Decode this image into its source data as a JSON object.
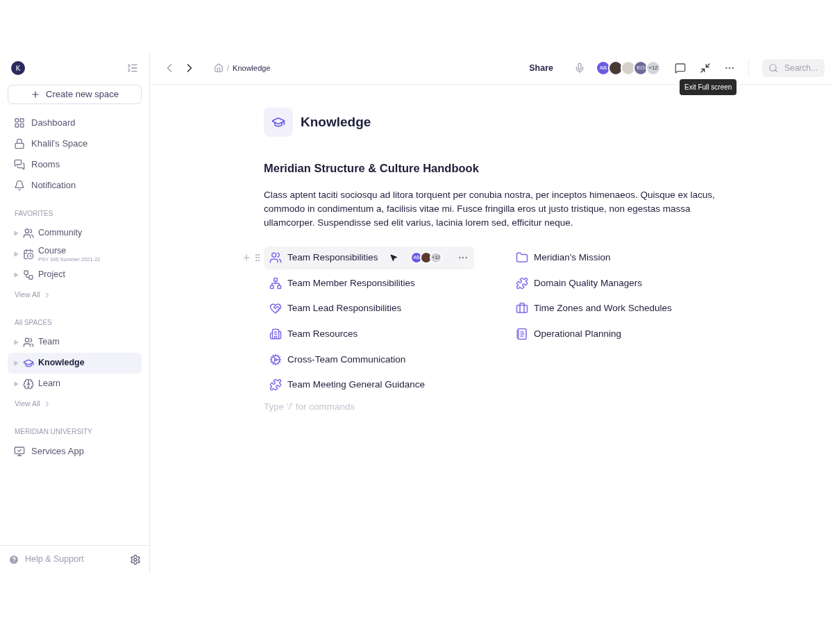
{
  "sidebar": {
    "avatar": "K",
    "create_button": "Create new space",
    "nav": [
      {
        "label": "Dashboard",
        "selected": false
      },
      {
        "label": "Khalil's Space",
        "selected": false
      },
      {
        "label": "Rooms",
        "selected": false
      },
      {
        "label": "Notification",
        "selected": false
      }
    ],
    "sections": [
      {
        "title": "FAVORITES",
        "items": [
          {
            "label": "Community",
            "selected": false
          },
          {
            "label": "Course",
            "subtitle": "PSY 345 Summer 2021-22",
            "selected": false
          },
          {
            "label": "Project",
            "selected": false
          }
        ],
        "view_all": "View All"
      },
      {
        "title": "All SPACES",
        "items": [
          {
            "label": "Team",
            "selected": false
          },
          {
            "label": "Knowledge",
            "selected": true
          },
          {
            "label": "Learn",
            "selected": false
          }
        ],
        "view_all": "View All"
      },
      {
        "title": "MERIDIAN UNIVERSITY",
        "apps": [
          {
            "label": "Services App"
          }
        ]
      }
    ],
    "help": "Help & Support"
  },
  "toolbar": {
    "breadcrumb_separator": "/",
    "breadcrumb": "Knowledge",
    "share": "Share",
    "avatars": [
      {
        "kind": "initials",
        "text": "AB",
        "color": "#6a5ae0"
      },
      {
        "kind": "photo",
        "color": "#4a3a36"
      },
      {
        "kind": "photo",
        "color": "#d8d0cc"
      },
      {
        "kind": "initials",
        "text": "KO",
        "color": "#6f6c99"
      },
      {
        "kind": "count",
        "text": "+12",
        "color": "#d4d4dc"
      }
    ],
    "tooltip": "Exit Full screen",
    "search": {
      "placeholder": "Search..."
    }
  },
  "page": {
    "title": "Knowledge",
    "heading": "Meridian Structure & Culture Handbook",
    "paragraph": "Class aptent taciti sociosqu ad litora torquent per conubia nostra, per inceptos himenaeos. Quisque ex lacus, commodo in condimentum a, facilisis vitae mi. Fusce fringilla eros ut justo tristique, non egestas massa ullamcorper. Suspendisse sed elit varius, lacinia lorem sed, efficitur neque.",
    "left_links": [
      {
        "label": "Team Responsibilities",
        "hovered": true,
        "avatars": [
          {
            "kind": "initials",
            "text": "AB",
            "color": "#6a5ae0"
          },
          {
            "kind": "photo",
            "color": "#5a3a30"
          },
          {
            "kind": "count",
            "text": "+12",
            "color": "#d4d4dc"
          }
        ]
      },
      {
        "label": "Team Member Responsibilities",
        "hovered": false
      },
      {
        "label": "Team Lead Responsibilities",
        "hovered": false
      },
      {
        "label": "Team Resources",
        "hovered": false
      },
      {
        "label": "Cross-Team Communication",
        "hovered": false
      },
      {
        "label": "Team Meeting General Guidance",
        "hovered": false
      }
    ],
    "right_links": [
      {
        "label": "Meridian's Mission"
      },
      {
        "label": "Domain Quality Managers"
      },
      {
        "label": "Time Zones and Work Schedules"
      },
      {
        "label": "Operational Planning"
      }
    ],
    "command_placeholder": "Type '/' for commands"
  }
}
